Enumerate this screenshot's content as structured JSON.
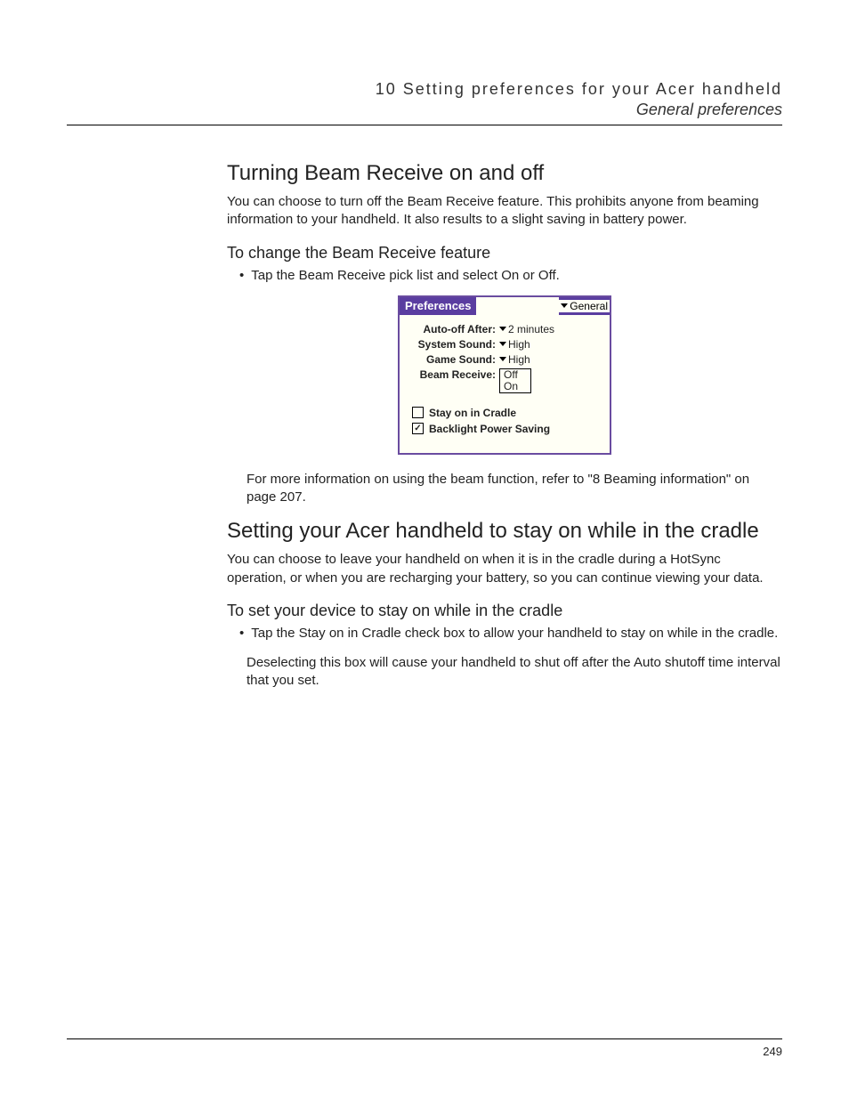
{
  "header": {
    "chapter": "10 Setting preferences for your Acer handheld",
    "section": "General preferences"
  },
  "section1": {
    "heading": "Turning Beam Receive on and off",
    "para": "You can choose to turn off the Beam Receive feature. This prohibits anyone from beaming information to your handheld. It also results to a slight saving in battery power.",
    "sub": "To change the Beam Receive feature",
    "bullet": "Tap the Beam Receive pick list and select On or Off.",
    "note": "For more information on using the beam function, refer to \"8 Beaming information\" on page 207."
  },
  "palm": {
    "title": "Preferences",
    "category": "General",
    "auto_off_label": "Auto-off After:",
    "auto_off_value": "2 minutes",
    "system_sound_label": "System Sound:",
    "system_sound_value": "High",
    "game_sound_label": "Game Sound:",
    "game_sound_value": "High",
    "beam_receive_label": "Beam Receive:",
    "beam_receive_option_off": "Off",
    "beam_receive_option_on": "On",
    "stay_on_label": "Stay on in Cradle",
    "backlight_label": "Backlight Power Saving"
  },
  "section2": {
    "heading": "Setting your Acer handheld to stay on while in the cradle",
    "para": "You can choose to leave your handheld on when it is in the cradle during a HotSync operation, or when you are recharging your battery, so you can continue viewing your data.",
    "sub": "To set your device to stay on while in the cradle",
    "bullet": "Tap the Stay on in Cradle check box to allow your handheld to stay on while in the cradle.",
    "note": "Deselecting this box will cause your handheld to shut off after the Auto shutoff time interval that you set."
  },
  "page_number": "249"
}
